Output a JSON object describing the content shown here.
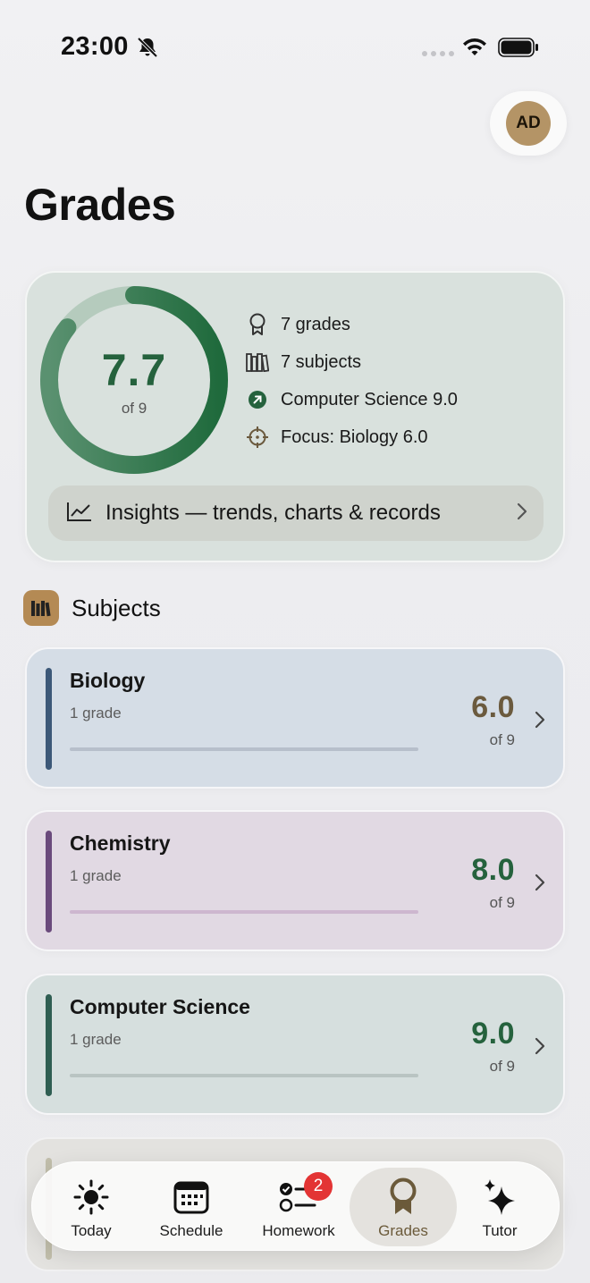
{
  "status_bar": {
    "time": "23:00"
  },
  "avatar": {
    "initials": "AD"
  },
  "page": {
    "title": "Grades"
  },
  "summary": {
    "average": "7.7",
    "scale": "of 9",
    "average_fraction": 0.856,
    "stats": [
      {
        "icon": "ribbon-icon",
        "label": "7 grades"
      },
      {
        "icon": "books-icon",
        "label": "7 subjects"
      },
      {
        "icon": "arrow-up-right-icon",
        "label": "Computer Science 9.0"
      },
      {
        "icon": "crosshair-icon",
        "label": "Focus: Biology 6.0"
      }
    ],
    "insights_label": "Insights — trends, charts & records"
  },
  "section": {
    "title": "Subjects"
  },
  "subjects": [
    {
      "name": "Biology",
      "count": "1 grade",
      "score": "6.0",
      "of": "of 9",
      "stripe": "#3c5878",
      "bg": "#d5dde6",
      "track": "#b7bfcb",
      "score_color": "#6b5a3e"
    },
    {
      "name": "Chemistry",
      "count": "1 grade",
      "score": "8.0",
      "of": "of 9",
      "stripe": "#6a4a7c",
      "bg": "#e1d9e3",
      "track": "#cdb7cf",
      "score_color": "#25623d"
    },
    {
      "name": "Computer Science",
      "count": "1 grade",
      "score": "9.0",
      "of": "of 9",
      "stripe": "#2f5e52",
      "bg": "#d6dfde",
      "track": "#b9c4c2",
      "score_color": "#25623d"
    }
  ],
  "tabs": [
    {
      "label": "Today",
      "icon": "sun-icon"
    },
    {
      "label": "Schedule",
      "icon": "calendar-icon"
    },
    {
      "label": "Homework",
      "icon": "checklist-icon",
      "badge": "2"
    },
    {
      "label": "Grades",
      "icon": "ribbon-icon",
      "active": true
    },
    {
      "label": "Tutor",
      "icon": "sparkles-icon"
    }
  ],
  "colors": {
    "accent_green": "#25623d",
    "brand_brown": "#b49466",
    "badge_red": "#e33434"
  }
}
